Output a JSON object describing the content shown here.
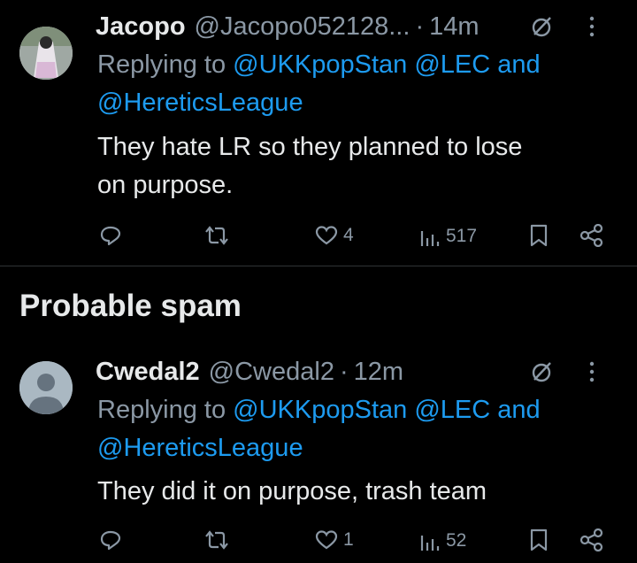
{
  "tweets": [
    {
      "name": "Jacopo",
      "handle": "@Jacopo052128...",
      "separator": "·",
      "time": "14m",
      "replying_prefix": "Replying to",
      "mentions_line1": "@UKKpopStan @LEC and",
      "mentions_line2": "@HereticsLeague",
      "text_line1": "They hate LR so they planned to lose",
      "text_line2": "on purpose.",
      "likes": "4",
      "views": "517"
    },
    {
      "name": "Cwedal2",
      "handle": "@Cwedal2",
      "separator": "·",
      "time": "12m",
      "replying_prefix": "Replying to",
      "mentions_line1": "@UKKpopStan @LEC and",
      "mentions_line2": "@HereticsLeague",
      "text_line1": "They did it on purpose, trash team",
      "likes": "1",
      "views": "52"
    }
  ],
  "section": {
    "title": "Probable spam"
  },
  "icons": [
    "ghost-icon",
    "more-icon",
    "reply-icon",
    "retweet-icon",
    "like-icon",
    "views-icon",
    "bookmark-icon",
    "share-icon"
  ],
  "colors": {
    "background": "#000000",
    "text": "#e7e9ea",
    "muted": "#8b98a5",
    "link": "#1d9bf0"
  }
}
